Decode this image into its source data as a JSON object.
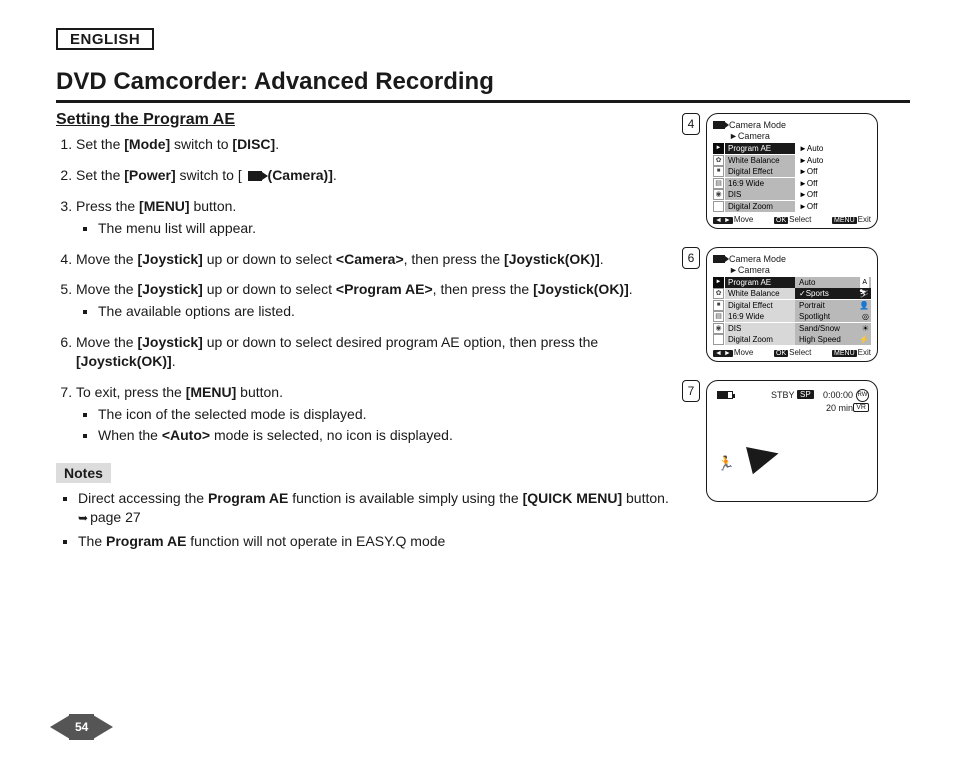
{
  "language_label": "ENGLISH",
  "title": "DVD Camcorder: Advanced Recording",
  "section_heading": "Setting the Program AE",
  "steps": {
    "s1_pre": "Set the ",
    "s1_b1": "[Mode]",
    "s1_mid": " switch to ",
    "s1_b2": "[DISC]",
    "s1_post": ".",
    "s2_pre": "Set the ",
    "s2_b1": "[Power]",
    "s2_mid": " switch to  [ ",
    "s2_b2": "(Camera)]",
    "s2_post": ".",
    "s3_pre": "Press the ",
    "s3_b1": "[MENU]",
    "s3_post": " button.",
    "s3_sub": "The menu list will appear.",
    "s4_pre": "Move the ",
    "s4_b1": "[Joystick]",
    "s4_mid": " up or down to select ",
    "s4_b2": "<Camera>",
    "s4_mid2": ", then press the ",
    "s4_b3": "[Joystick(OK)]",
    "s4_post": ".",
    "s5_pre": "Move the ",
    "s5_b1": "[Joystick]",
    "s5_mid": " up or down to select ",
    "s5_b2": "<Program AE>",
    "s5_mid2": ", then press the ",
    "s5_b3": "[Joystick(OK)]",
    "s5_post": ".",
    "s5_sub": "The available options are listed.",
    "s6_pre": "Move the ",
    "s6_b1": "[Joystick]",
    "s6_mid": " up or down to select desired program AE option, then press the ",
    "s6_b2": "[Joystick(OK)]",
    "s6_post": ".",
    "s7_pre": "To exit, press the ",
    "s7_b1": "[MENU]",
    "s7_post": " button.",
    "s7_sub1": "The icon of the selected mode is displayed.",
    "s7_sub2_pre": "When the ",
    "s7_sub2_b": "<Auto>",
    "s7_sub2_post": " mode is selected, no icon is displayed."
  },
  "notes_label": "Notes",
  "notes": {
    "n1_pre": "Direct accessing the ",
    "n1_b1": "Program AE",
    "n1_mid": " function is available simply using the ",
    "n1_b2": "[QUICK MENU]",
    "n1_post": " button. ",
    "n1_link": "page 27",
    "n2_pre": "The ",
    "n2_b1": "Program AE",
    "n2_post": " function will not operate in EASY.Q mode"
  },
  "page_number": "54",
  "figures": {
    "f4": {
      "num": "4",
      "mode": "Camera Mode",
      "nav": "►Camera",
      "rows": [
        {
          "label": "Program AE",
          "val": "►Auto"
        },
        {
          "label": "White Balance",
          "val": "►Auto"
        },
        {
          "label": "Digital Effect",
          "val": "►Off"
        },
        {
          "label": "16:9 Wide",
          "val": "►Off"
        },
        {
          "label": "DIS",
          "val": "►Off"
        },
        {
          "label": "Digital Zoom",
          "val": "►Off"
        }
      ],
      "foot": {
        "move": "Move",
        "select": "Select",
        "exit": "Exit",
        "ok": "OK",
        "menu": "MENU"
      }
    },
    "f6": {
      "num": "6",
      "mode": "Camera Mode",
      "nav": "►Camera",
      "rows": [
        {
          "label": "Program AE",
          "val": "Auto",
          "icon": "A"
        },
        {
          "label": "White Balance",
          "val": "Sports",
          "check": true
        },
        {
          "label": "Digital Effect",
          "val": "Portrait"
        },
        {
          "label": "16:9 Wide",
          "val": "Spotlight"
        },
        {
          "label": "DIS",
          "val": "Sand/Snow"
        },
        {
          "label": "Digital Zoom",
          "val": "High Speed"
        }
      ],
      "foot": {
        "move": "Move",
        "select": "Select",
        "exit": "Exit",
        "ok": "OK",
        "menu": "MENU"
      }
    },
    "f7": {
      "num": "7",
      "stby": "STBY",
      "sp": "SP",
      "time": "0:00:00",
      "rw": "RW",
      "remain": "20 min",
      "vr": "VR"
    }
  }
}
